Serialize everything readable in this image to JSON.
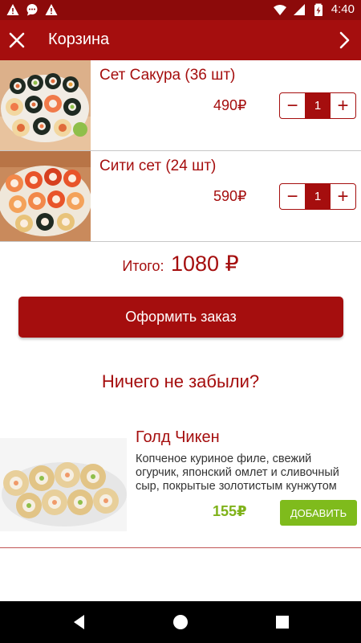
{
  "status_bar": {
    "time": "4:40",
    "icons": [
      "warning-icon",
      "chat-icon",
      "warning-icon",
      "wifi-icon",
      "signal-icon",
      "battery-icon"
    ]
  },
  "app_bar": {
    "title": "Корзина",
    "close_icon": "close-icon",
    "next_icon": "chevron-right-icon"
  },
  "cart": {
    "items": [
      {
        "name": "Сет Сакура (36 шт)",
        "price": "490₽",
        "quantity": "1",
        "minus": "−",
        "plus": "+"
      },
      {
        "name": "Сити сет (24 шт)",
        "price": "590₽",
        "quantity": "1",
        "minus": "−",
        "plus": "+"
      }
    ],
    "total_label": "Итого:",
    "total_value": "1080 ₽",
    "order_button": "Оформить заказ"
  },
  "upsell": {
    "heading": "Ничего не забыли?",
    "items": [
      {
        "name": "Голд Чикен",
        "description": "Копченое куриное филе, свежий огурчик, японский омлет и сливочный сыр, покрытые золотистым кунжутом",
        "price": "155₽",
        "add_button": "ДОБАВИТЬ"
      }
    ]
  },
  "nav_bar": {
    "icons": [
      "back-icon",
      "home-icon",
      "recents-icon"
    ]
  },
  "colors": {
    "primary": "#a50e0e",
    "status_bar": "#8c0a0a",
    "accent_green": "#7fbb1c",
    "price_green": "#7fb21a"
  }
}
